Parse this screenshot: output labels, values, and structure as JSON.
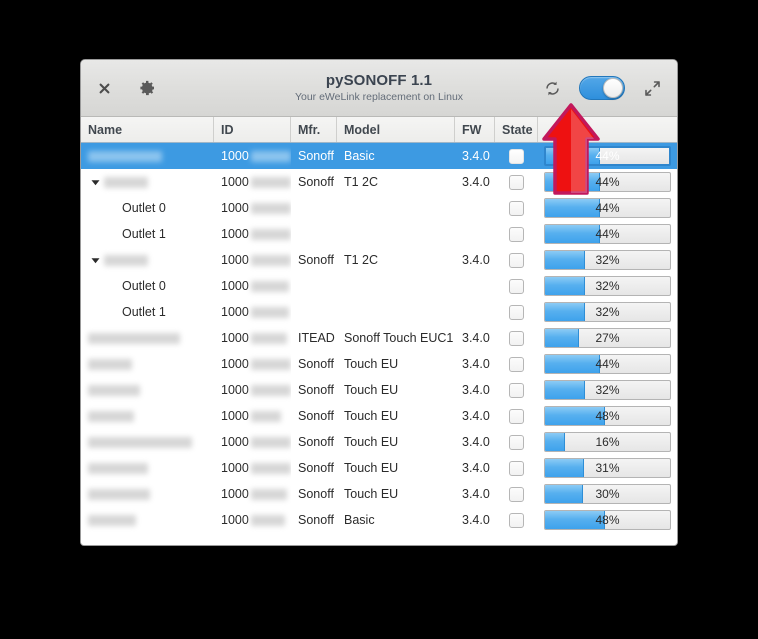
{
  "window": {
    "title": "pySONOFF 1.1",
    "subtitle": "Your eWeLink replacement on Linux",
    "close_label": "×",
    "icons": {
      "close": "close-icon",
      "settings": "gear-icon",
      "refresh": "refresh-icon",
      "toggle": "power-toggle",
      "fullscreen": "fullscreen-icon"
    }
  },
  "table": {
    "columns": [
      {
        "key": "name",
        "label": "Name",
        "width": 133
      },
      {
        "key": "id",
        "label": "ID",
        "width": 77
      },
      {
        "key": "mfr",
        "label": "Mfr.",
        "width": 46
      },
      {
        "key": "model",
        "label": "Model",
        "width": 118
      },
      {
        "key": "fw",
        "label": "FW",
        "width": 40
      },
      {
        "key": "state",
        "label": "State",
        "width": 43
      },
      {
        "key": "rssi",
        "label": "",
        "width": 139
      }
    ],
    "rows": [
      {
        "indent": 0,
        "twisty": "none",
        "name": "",
        "name_redacted": 74,
        "id": "1000",
        "id_redacted": 60,
        "mfr": "Sonoff",
        "model": "Basic",
        "fw": "3.4.0",
        "checked": false,
        "percent": 44,
        "percent_label": "44%",
        "selected": true
      },
      {
        "indent": 0,
        "twisty": "expanded",
        "name": "",
        "name_redacted": 44,
        "id": "1000",
        "id_redacted": 43,
        "mfr": "Sonoff",
        "model": "T1 2C",
        "fw": "3.4.0",
        "checked": false,
        "percent": 44,
        "percent_label": "44%",
        "selected": false
      },
      {
        "indent": 1,
        "twisty": "none",
        "name": "Outlet 0",
        "name_redacted": 0,
        "id": "1000",
        "id_redacted": 40,
        "mfr": "",
        "model": "",
        "fw": "",
        "checked": false,
        "percent": 44,
        "percent_label": "44%",
        "selected": false
      },
      {
        "indent": 1,
        "twisty": "none",
        "name": "Outlet 1",
        "name_redacted": 0,
        "id": "1000",
        "id_redacted": 40,
        "mfr": "",
        "model": "",
        "fw": "",
        "checked": false,
        "percent": 44,
        "percent_label": "44%",
        "selected": false
      },
      {
        "indent": 0,
        "twisty": "expanded",
        "name": "",
        "name_redacted": 44,
        "id": "1000",
        "id_redacted": 42,
        "mfr": "Sonoff",
        "model": "T1 2C",
        "fw": "3.4.0",
        "checked": false,
        "percent": 32,
        "percent_label": "32%",
        "selected": false
      },
      {
        "indent": 1,
        "twisty": "none",
        "name": "Outlet 0",
        "name_redacted": 0,
        "id": "1000",
        "id_redacted": 38,
        "mfr": "",
        "model": "",
        "fw": "",
        "checked": false,
        "percent": 32,
        "percent_label": "32%",
        "selected": false
      },
      {
        "indent": 1,
        "twisty": "none",
        "name": "Outlet 1",
        "name_redacted": 0,
        "id": "1000",
        "id_redacted": 38,
        "mfr": "",
        "model": "",
        "fw": "",
        "checked": false,
        "percent": 32,
        "percent_label": "32%",
        "selected": false
      },
      {
        "indent": 0,
        "twisty": "none",
        "name": "",
        "name_redacted": 92,
        "id": "1000",
        "id_redacted": 36,
        "mfr": "ITEAD",
        "model": "Sonoff Touch EUC1",
        "fw": "3.4.0",
        "checked": false,
        "percent": 27,
        "percent_label": "27%",
        "selected": false
      },
      {
        "indent": 0,
        "twisty": "none",
        "name": "",
        "name_redacted": 44,
        "id": "1000",
        "id_redacted": 42,
        "mfr": "Sonoff",
        "model": "Touch EU",
        "fw": "3.4.0",
        "checked": false,
        "percent": 44,
        "percent_label": "44%",
        "selected": false
      },
      {
        "indent": 0,
        "twisty": "none",
        "name": "",
        "name_redacted": 52,
        "id": "1000",
        "id_redacted": 42,
        "mfr": "Sonoff",
        "model": "Touch EU",
        "fw": "3.4.0",
        "checked": false,
        "percent": 32,
        "percent_label": "32%",
        "selected": false
      },
      {
        "indent": 0,
        "twisty": "none",
        "name": "",
        "name_redacted": 46,
        "id": "1000",
        "id_redacted": 30,
        "mfr": "Sonoff",
        "model": "Touch EU",
        "fw": "3.4.0",
        "checked": false,
        "percent": 48,
        "percent_label": "48%",
        "selected": false
      },
      {
        "indent": 0,
        "twisty": "none",
        "name": "",
        "name_redacted": 104,
        "id": "1000",
        "id_redacted": 40,
        "mfr": "Sonoff",
        "model": "Touch EU",
        "fw": "3.4.0",
        "checked": false,
        "percent": 16,
        "percent_label": "16%",
        "selected": false
      },
      {
        "indent": 0,
        "twisty": "none",
        "name": "",
        "name_redacted": 60,
        "id": "1000",
        "id_redacted": 42,
        "mfr": "Sonoff",
        "model": "Touch EU",
        "fw": "3.4.0",
        "checked": false,
        "percent": 31,
        "percent_label": "31%",
        "selected": false
      },
      {
        "indent": 0,
        "twisty": "none",
        "name": "",
        "name_redacted": 62,
        "id": "1000",
        "id_redacted": 36,
        "mfr": "Sonoff",
        "model": "Touch EU",
        "fw": "3.4.0",
        "checked": false,
        "percent": 30,
        "percent_label": "30%",
        "selected": false
      },
      {
        "indent": 0,
        "twisty": "none",
        "name": "",
        "name_redacted": 48,
        "id": "1000",
        "id_redacted": 34,
        "mfr": "Sonoff",
        "model": "Basic",
        "fw": "3.4.0",
        "checked": false,
        "percent": 48,
        "percent_label": "48%",
        "selected": false
      }
    ]
  },
  "annotation": {
    "shape": "up-arrow",
    "points_at": "refresh-icon",
    "fill": "#ee1111",
    "stroke": "#c2185b"
  },
  "colors": {
    "accent": "#3d9ae2",
    "titlebar": "#dededc",
    "header_text": "#41484f",
    "progress_fill": "#57b0ef"
  }
}
